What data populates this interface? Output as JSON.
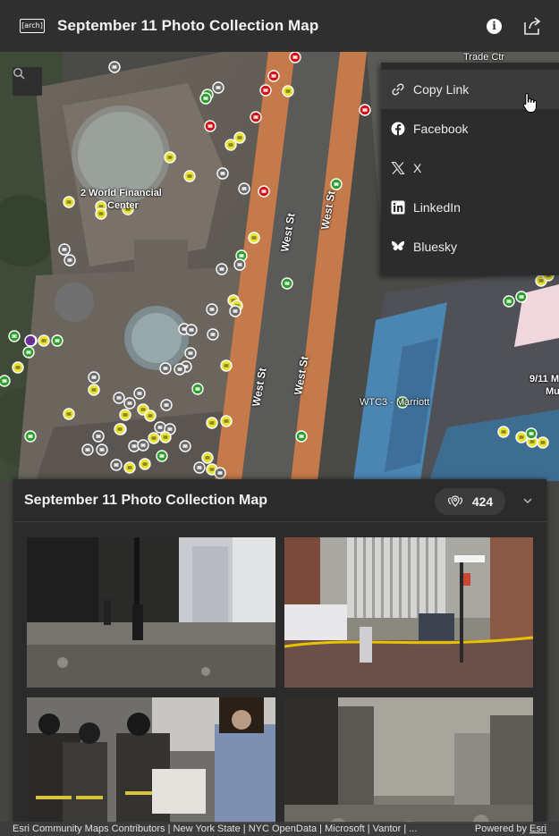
{
  "header": {
    "logo_text": "[arch]",
    "title": "September 11 Photo Collection Map"
  },
  "share_menu": {
    "items": [
      {
        "label": "Copy Link",
        "icon": "link-icon"
      },
      {
        "label": "Facebook",
        "icon": "facebook-icon"
      },
      {
        "label": "X",
        "icon": "x-icon"
      },
      {
        "label": "LinkedIn",
        "icon": "linkedin-icon"
      },
      {
        "label": "Bluesky",
        "icon": "bluesky-icon"
      }
    ]
  },
  "map": {
    "labels": {
      "west_st": "West St",
      "two_world_financial": "2 World Financial",
      "two_world_financial_2": "Center",
      "wtc3": "WTC3 - Marriott",
      "trade_ctr": "Trade Ctr",
      "nine_eleven": "9/11 M",
      "nine_eleven_2": "Mu"
    }
  },
  "panel": {
    "title": "September 11 Photo Collection Map",
    "count": "424",
    "photos": [
      {
        "alt": "Debris-covered plaza between buildings"
      },
      {
        "alt": "Street with debris and a police van"
      },
      {
        "alt": "Firefighters carrying a stretcher"
      },
      {
        "alt": "Dust-covered street and buildings"
      }
    ]
  },
  "attribution": {
    "text": "Esri Community Maps Contributors | New York State | NYC OpenData | Microsoft | Vantor | ...",
    "powered_by": "Powered by",
    "esri": "Esri"
  },
  "colors": {
    "header_bg": "#2f2f2f",
    "marker_red": "#d0141a",
    "marker_yellow": "#e8e236",
    "marker_green": "#2f9e2f",
    "marker_gray": "#6c6c6c",
    "west_st_road": "#c47a4a"
  }
}
